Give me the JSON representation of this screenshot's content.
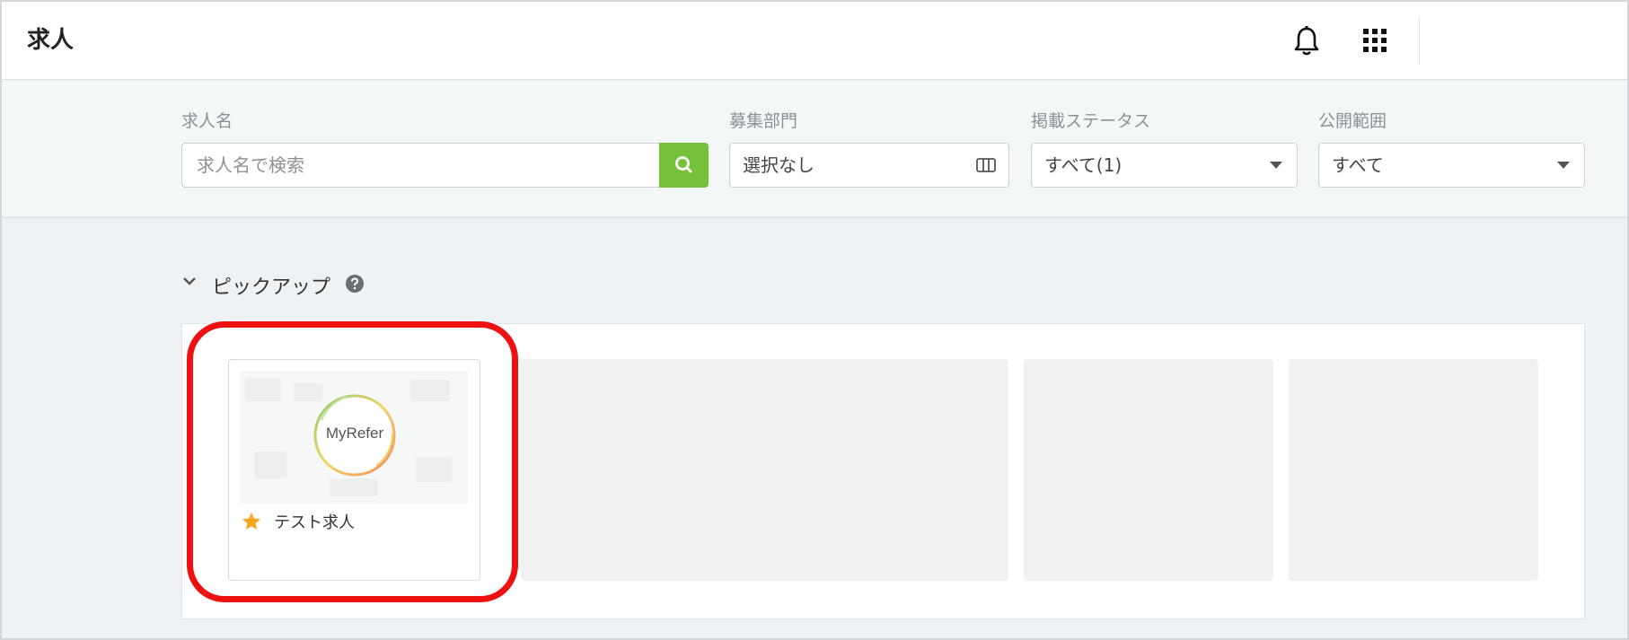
{
  "header": {
    "title": "求人",
    "icons": {
      "bell": "bell-icon",
      "apps": "apps-grid-icon"
    }
  },
  "filters": {
    "job_name": {
      "label": "求人名",
      "placeholder": "求人名で検索"
    },
    "department": {
      "label": "募集部門",
      "value": "選択なし"
    },
    "status": {
      "label": "掲載ステータス",
      "value": "すべて(1)"
    },
    "scope": {
      "label": "公開範囲",
      "value": "すべて"
    }
  },
  "pickup": {
    "title": "ピックアップ",
    "cards": [
      {
        "title": "テスト求人",
        "logo_text": "MyRefer",
        "starred": true
      }
    ],
    "empty_slots": 4
  },
  "colors": {
    "accent_green": "#76c13a",
    "highlight_red": "#ee1111",
    "star_orange": "#f5a623"
  }
}
